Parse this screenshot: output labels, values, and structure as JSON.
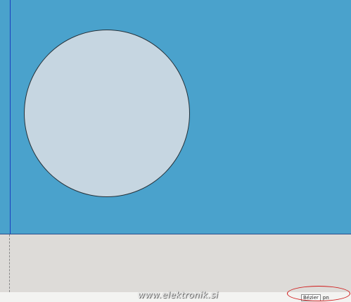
{
  "canvas": {
    "background_color": "#4aa2cc",
    "shape_fill_color": "#c6d6e1",
    "shape_outline_color": "#26323a"
  },
  "watermark": {
    "text": "www.elektronik.si"
  },
  "status_bar": {
    "field_label": "Bézier",
    "value_text": "pn"
  },
  "annotation": {
    "highlight_color": "#d01818"
  }
}
